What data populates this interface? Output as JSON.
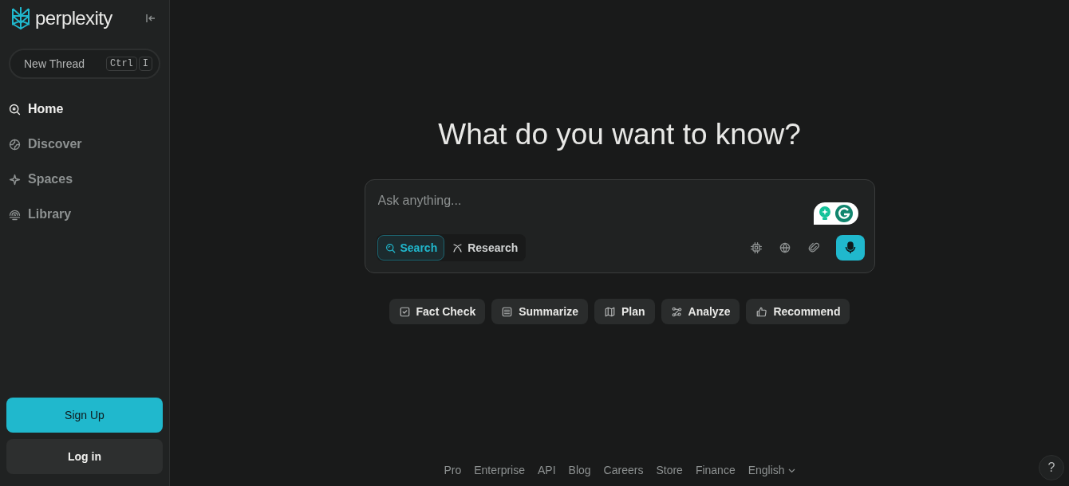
{
  "sidebar": {
    "logo_text": "perplexity",
    "new_thread": {
      "label": "New Thread",
      "shortcut": [
        "Ctrl",
        "I"
      ]
    },
    "items": [
      {
        "label": "Home",
        "selected": true
      },
      {
        "label": "Discover",
        "selected": false
      },
      {
        "label": "Spaces",
        "selected": false
      },
      {
        "label": "Library",
        "selected": false
      }
    ],
    "sign_up": "Sign Up",
    "log_in": "Log in"
  },
  "main": {
    "heading": "What do you want to know?",
    "search_box": {
      "placeholder": "Ask anything...",
      "modes": [
        {
          "label": "Search",
          "selected": true
        },
        {
          "label": "Research",
          "selected": false
        }
      ]
    },
    "suggestions": [
      "Fact Check",
      "Summarize",
      "Plan",
      "Analyze",
      "Recommend"
    ]
  },
  "footer": {
    "links": [
      "Pro",
      "Enterprise",
      "API",
      "Blog",
      "Careers",
      "Store",
      "Finance"
    ],
    "language": "English",
    "help": "?"
  }
}
